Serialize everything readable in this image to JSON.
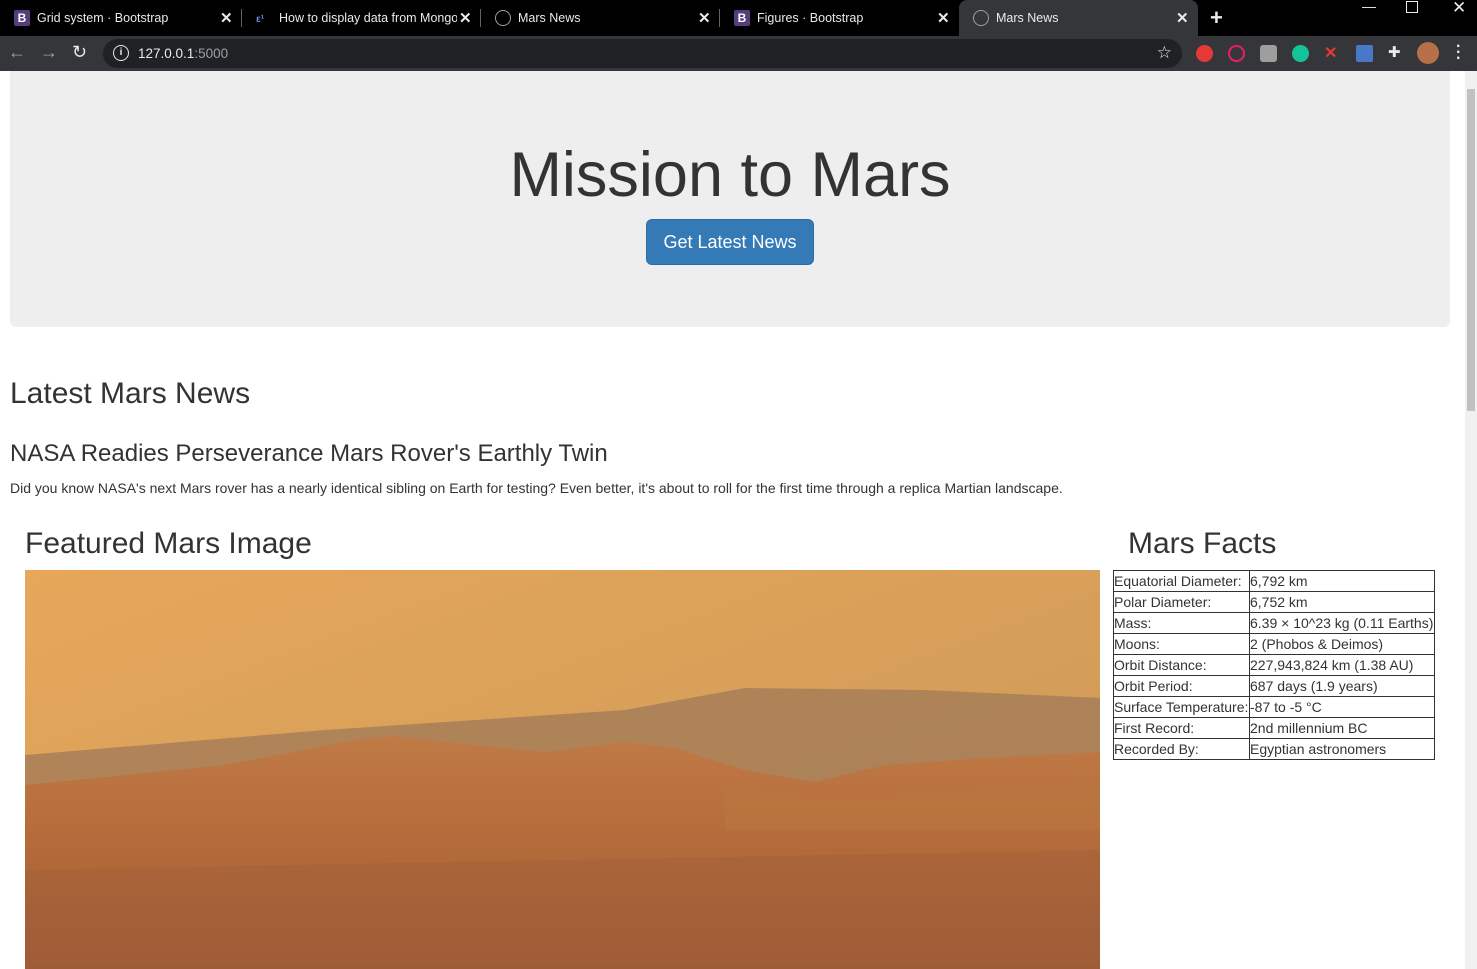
{
  "browser": {
    "tabs": [
      {
        "title": "Grid system · Bootstrap",
        "favicon": "bootstrap-icon",
        "active": false
      },
      {
        "title": "How to display data from Mongo",
        "favicon": "site-icon",
        "active": false
      },
      {
        "title": "Mars News",
        "favicon": "globe-icon",
        "active": false
      },
      {
        "title": "Figures · Bootstrap",
        "favicon": "bootstrap-icon",
        "active": false
      },
      {
        "title": "Mars News",
        "favicon": "globe-icon",
        "active": true
      }
    ],
    "favicon_letter": "B",
    "url_host": "127.0.0.1",
    "url_port": ":5000"
  },
  "jumbotron": {
    "title": "Mission to Mars",
    "button_label": "Get Latest News"
  },
  "news": {
    "heading": "Latest Mars News",
    "title": "NASA Readies Perseverance Mars Rover's Earthly Twin",
    "paragraph": "Did you know NASA's next Mars rover has a nearly identical sibling on Earth for testing? Even better, it's about to roll for the first time through a replica Martian landscape."
  },
  "featured_image": {
    "heading": "Featured Mars Image"
  },
  "facts": {
    "heading": "Mars Facts",
    "rows": [
      {
        "label": "Equatorial Diameter:",
        "value": "6,792 km"
      },
      {
        "label": "Polar Diameter:",
        "value": "6,752 km"
      },
      {
        "label": "Mass:",
        "value": "6.39 × 10^23 kg (0.11 Earths)"
      },
      {
        "label": "Moons:",
        "value": "2 (Phobos & Deimos)"
      },
      {
        "label": "Orbit Distance:",
        "value": "227,943,824 km (1.38 AU)"
      },
      {
        "label": "Orbit Period:",
        "value": "687 days (1.9 years)"
      },
      {
        "label": "Surface Temperature:",
        "value": "-87 to -5 °C"
      },
      {
        "label": "First Record:",
        "value": "2nd millennium BC"
      },
      {
        "label": "Recorded By:",
        "value": "Egyptian astronomers"
      }
    ]
  },
  "colors": {
    "tabstrip": "#000000",
    "toolbar": "#35363a",
    "jumbotron_bg": "#eeeeee",
    "button_primary": "#337ab7",
    "text": "#333333"
  }
}
